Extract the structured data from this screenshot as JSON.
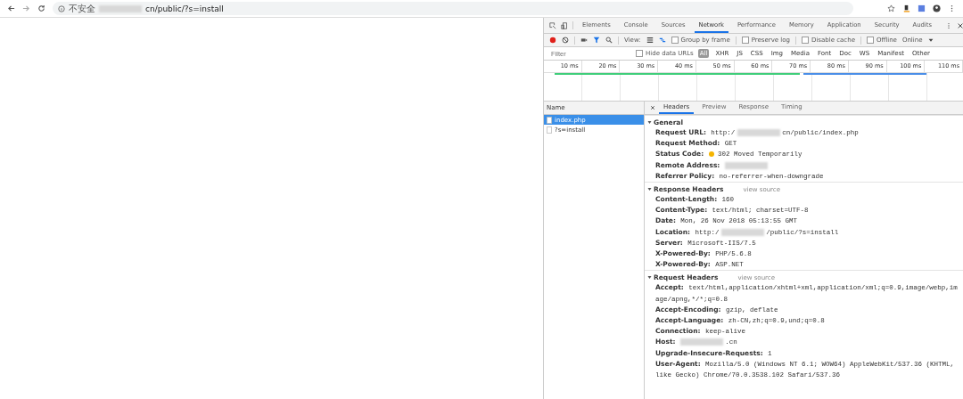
{
  "browser": {
    "security_label": "不安全",
    "url_suffix": "cn/public/?s=install",
    "url_redacted": true
  },
  "devtools": {
    "tabs": [
      {
        "label": "Elements",
        "selected": false
      },
      {
        "label": "Console",
        "selected": false
      },
      {
        "label": "Sources",
        "selected": false
      },
      {
        "label": "Network",
        "selected": true
      },
      {
        "label": "Performance",
        "selected": false
      },
      {
        "label": "Memory",
        "selected": false
      },
      {
        "label": "Application",
        "selected": false
      },
      {
        "label": "Security",
        "selected": false
      },
      {
        "label": "Audits",
        "selected": false
      }
    ],
    "toolbar": {
      "recording": true,
      "filter_on": true,
      "view_label": "View:",
      "large_rows": false,
      "waterfall_on": true,
      "options": [
        {
          "label": "Group by frame",
          "checked": false
        },
        {
          "label": "Preserve log",
          "checked": false
        },
        {
          "label": "Disable cache",
          "checked": false
        },
        {
          "label": "Offline",
          "checked": false
        }
      ],
      "throttle": "Online"
    },
    "filter_bar": {
      "placeholder": "Filter",
      "hide_data_urls": {
        "label": "Hide data URLs",
        "checked": false
      },
      "types": [
        {
          "label": "All",
          "selected": true
        },
        {
          "label": "XHR",
          "selected": false
        },
        {
          "label": "JS",
          "selected": false
        },
        {
          "label": "CSS",
          "selected": false
        },
        {
          "label": "Img",
          "selected": false
        },
        {
          "label": "Media",
          "selected": false
        },
        {
          "label": "Font",
          "selected": false
        },
        {
          "label": "Doc",
          "selected": false
        },
        {
          "label": "WS",
          "selected": false
        },
        {
          "label": "Manifest",
          "selected": false
        },
        {
          "label": "Other",
          "selected": false
        }
      ]
    },
    "timeline": {
      "ticks": [
        "10 ms",
        "20 ms",
        "30 ms",
        "40 ms",
        "50 ms",
        "60 ms",
        "70 ms",
        "80 ms",
        "90 ms",
        "100 ms",
        "110 ms"
      ]
    },
    "requests": {
      "column": "Name",
      "items": [
        {
          "name": "index.php",
          "selected": true
        },
        {
          "name": "?s=install",
          "selected": false
        }
      ]
    },
    "detail_tabs": [
      {
        "label": "Headers",
        "selected": true
      },
      {
        "label": "Preview",
        "selected": false
      },
      {
        "label": "Response",
        "selected": false
      },
      {
        "label": "Timing",
        "selected": false
      }
    ],
    "sections": [
      {
        "title": "General",
        "expanded": true,
        "rows": [
          {
            "name": "Request URL:",
            "value": "http:/",
            "redacted": true,
            "value_after": "cn/public/index.php"
          },
          {
            "name": "Request Method:",
            "value": "GET"
          },
          {
            "name": "Status Code:",
            "value": "302 Moved Temporarily",
            "kind": "status"
          },
          {
            "name": "Remote Address:",
            "value": "",
            "redacted": true
          },
          {
            "name": "Referrer Policy:",
            "value": "no-referrer-when-downgrade"
          }
        ]
      },
      {
        "title": "Response Headers",
        "expanded": true,
        "link": "view source",
        "rows": [
          {
            "name": "Content-Length:",
            "value": "160"
          },
          {
            "name": "Content-Type:",
            "value": "text/html; charset=UTF-8"
          },
          {
            "name": "Date:",
            "value": "Mon, 26 Nov 2018 05:13:55 GMT"
          },
          {
            "name": "Location:",
            "value": "http:/",
            "redacted": true,
            "value_after": "/public/?s=install"
          },
          {
            "name": "Server:",
            "value": "Microsoft-IIS/7.5"
          },
          {
            "name": "X-Powered-By:",
            "value": "PHP/5.6.8"
          },
          {
            "name": "X-Powered-By:",
            "value": "ASP.NET"
          }
        ]
      },
      {
        "title": "Request Headers",
        "expanded": true,
        "link": "view source",
        "rows": [
          {
            "name": "Accept:",
            "value": "text/html,application/xhtml+xml,application/xml;q=0.9,image/webp,image/apng,*/*;q=0.8"
          },
          {
            "name": "Accept-Encoding:",
            "value": "gzip, deflate"
          },
          {
            "name": "Accept-Language:",
            "value": "zh-CN,zh;q=0.9,und;q=0.8"
          },
          {
            "name": "Connection:",
            "value": "keep-alive"
          },
          {
            "name": "Host:",
            "value": "",
            "redacted": true,
            "value_after": ".cn"
          },
          {
            "name": "Upgrade-Insecure-Requests:",
            "value": "1"
          },
          {
            "name": "User-Agent:",
            "value": "Mozilla/5.0 (Windows NT 6.1; WOW64) AppleWebKit/537.36 (KHTML, like Gecko) Chrome/70.0.3538.102 Safari/537.36"
          }
        ]
      }
    ]
  }
}
